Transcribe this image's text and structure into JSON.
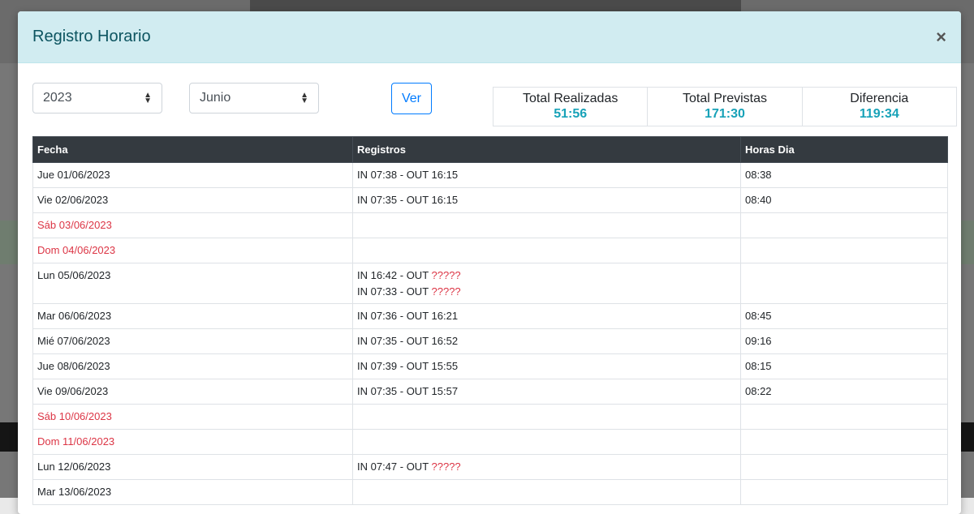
{
  "modal": {
    "title": "Registro Horario",
    "close_symbol": "×"
  },
  "filters": {
    "year": "2023",
    "month": "Junio",
    "view_button": "Ver"
  },
  "totals": [
    {
      "label": "Total Realizadas",
      "value": "51:56"
    },
    {
      "label": "Total Previstas",
      "value": "171:30"
    },
    {
      "label": "Diferencia",
      "value": "119:34"
    }
  ],
  "table": {
    "headers": [
      "Fecha",
      "Registros",
      "Horas Dia"
    ],
    "rows": [
      {
        "fecha": "Jue 01/06/2023",
        "weekend": false,
        "registros": [
          {
            "in": "IN 07:38 - OUT ",
            "out": "16:15",
            "missing": false
          }
        ],
        "horas": "08:38"
      },
      {
        "fecha": "Vie 02/06/2023",
        "weekend": false,
        "registros": [
          {
            "in": "IN 07:35 - OUT ",
            "out": "16:15",
            "missing": false
          }
        ],
        "horas": "08:40"
      },
      {
        "fecha": "Sáb 03/06/2023",
        "weekend": true,
        "registros": [],
        "horas": ""
      },
      {
        "fecha": "Dom 04/06/2023",
        "weekend": true,
        "registros": [],
        "horas": ""
      },
      {
        "fecha": "Lun 05/06/2023",
        "weekend": false,
        "registros": [
          {
            "in": "IN 16:42 - OUT ",
            "out": "?????",
            "missing": true
          },
          {
            "in": "IN 07:33 - OUT ",
            "out": "?????",
            "missing": true
          }
        ],
        "horas": ""
      },
      {
        "fecha": "Mar 06/06/2023",
        "weekend": false,
        "registros": [
          {
            "in": "IN 07:36 - OUT ",
            "out": "16:21",
            "missing": false
          }
        ],
        "horas": "08:45"
      },
      {
        "fecha": "Mié 07/06/2023",
        "weekend": false,
        "registros": [
          {
            "in": "IN 07:35 - OUT ",
            "out": "16:52",
            "missing": false
          }
        ],
        "horas": "09:16"
      },
      {
        "fecha": "Jue 08/06/2023",
        "weekend": false,
        "registros": [
          {
            "in": "IN 07:39 - OUT ",
            "out": "15:55",
            "missing": false
          }
        ],
        "horas": "08:15"
      },
      {
        "fecha": "Vie 09/06/2023",
        "weekend": false,
        "registros": [
          {
            "in": "IN 07:35 - OUT ",
            "out": "15:57",
            "missing": false
          }
        ],
        "horas": "08:22"
      },
      {
        "fecha": "Sáb 10/06/2023",
        "weekend": true,
        "registros": [],
        "horas": ""
      },
      {
        "fecha": "Dom 11/06/2023",
        "weekend": true,
        "registros": [],
        "horas": ""
      },
      {
        "fecha": "Lun 12/06/2023",
        "weekend": false,
        "registros": [
          {
            "in": "IN 07:47 - OUT ",
            "out": "?????",
            "missing": true
          }
        ],
        "horas": ""
      },
      {
        "fecha": "Mar 13/06/2023",
        "weekend": false,
        "registros": [],
        "horas": ""
      }
    ]
  }
}
